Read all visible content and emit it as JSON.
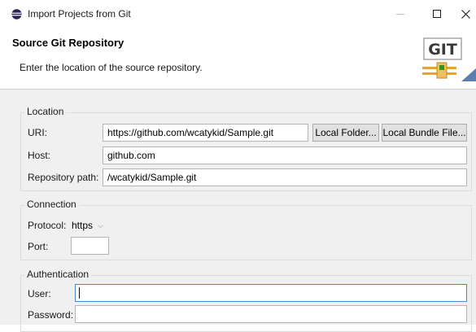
{
  "window": {
    "title": "Import Projects from Git"
  },
  "header": {
    "title": "Source Git Repository",
    "description": "Enter the location of the source repository.",
    "logo_text": "GIT"
  },
  "location": {
    "group_label": "Location",
    "uri_label": "URI:",
    "uri_value": "https://github.com/wcatykid/Sample.git",
    "local_folder_button": "Local Folder...",
    "local_bundle_button": "Local Bundle File...",
    "host_label": "Host:",
    "host_value": "github.com",
    "repo_path_label": "Repository path:",
    "repo_path_value": "/wcatykid/Sample.git"
  },
  "connection": {
    "group_label": "Connection",
    "protocol_label": "Protocol:",
    "protocol_value": "https",
    "port_label": "Port:",
    "port_value": ""
  },
  "authentication": {
    "group_label": "Authentication",
    "user_label": "User:",
    "user_value": "",
    "password_label": "Password:",
    "password_value": ""
  },
  "colors": {
    "focus_border": "#4a86c8",
    "logo_green": "#3a8a3a",
    "logo_orange": "#e8a23a"
  }
}
